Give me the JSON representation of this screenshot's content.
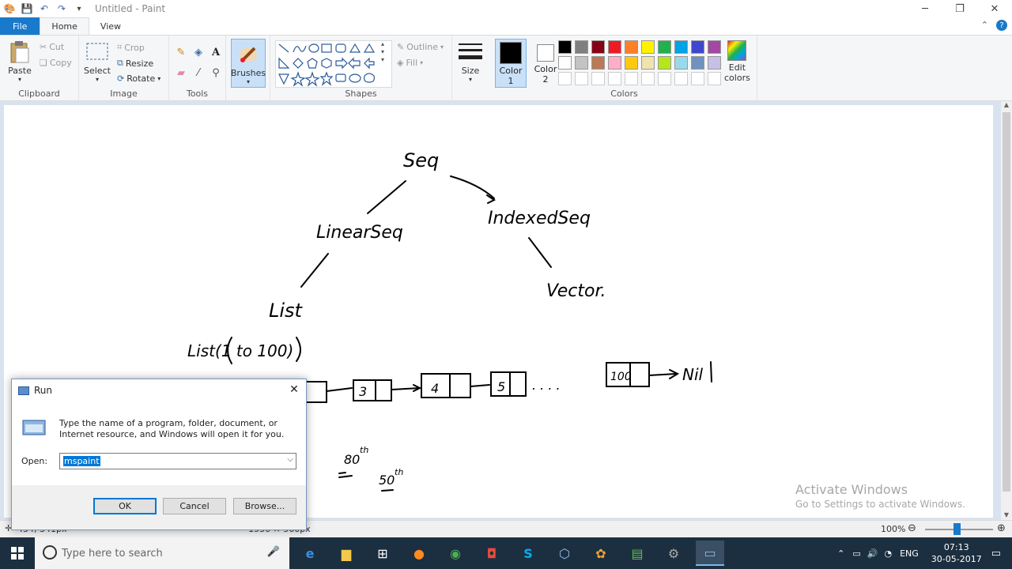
{
  "window": {
    "title": "Untitled - Paint"
  },
  "tabs": [
    {
      "label": "File"
    },
    {
      "label": "Home"
    },
    {
      "label": "View"
    }
  ],
  "ribbon": {
    "clipboard": {
      "label": "Clipboard",
      "paste": "Paste",
      "cut": "Cut",
      "copy": "Copy"
    },
    "image": {
      "label": "Image",
      "select": "Select",
      "crop": "Crop",
      "resize": "Resize",
      "rotate": "Rotate"
    },
    "tools": {
      "label": "Tools"
    },
    "brushes": {
      "label": "Brushes"
    },
    "shapes": {
      "label": "Shapes",
      "outline": "Outline",
      "fill": "Fill"
    },
    "size": {
      "label": "Size"
    },
    "colors": {
      "label": "Colors",
      "color1": "Color",
      "color1_num": "1",
      "color2": "Color",
      "color2_num": "2",
      "edit": "Edit",
      "edit2": "colors",
      "color1_hex": "#000000",
      "color2_hex": "#ffffff",
      "palette_row1": [
        "#000000",
        "#7f7f7f",
        "#880015",
        "#ed1c24",
        "#ff7f27",
        "#fff200",
        "#22b14c",
        "#00a2e8",
        "#3f48cc",
        "#a349a4"
      ],
      "palette_row2": [
        "#ffffff",
        "#c3c3c3",
        "#b97a57",
        "#ffaec9",
        "#ffc90e",
        "#efe4b0",
        "#b5e61d",
        "#99d9ea",
        "#7092be",
        "#c8bfe7"
      ]
    }
  },
  "canvas_text": {
    "seq": "Seq",
    "linear_seq": "LinearSeq",
    "indexed_seq": "IndexedSeq",
    "vector": "Vector.",
    "list": "List",
    "list_call": "List(1 to 100)",
    "node3": "3",
    "node4": "4",
    "node5": "5",
    "dots": ". . . .",
    "node100": "100",
    "nil": "Nil",
    "n80": "80",
    "n80_sup": "th",
    "n50": "50",
    "n50_sup": "th"
  },
  "statusbar": {
    "position": "434, 341px",
    "size": "1536 × 560px",
    "zoom": "100%"
  },
  "watermark": {
    "line1": "Activate Windows",
    "line2": "Go to Settings to activate Windows."
  },
  "run_dialog": {
    "title": "Run",
    "description": "Type the name of a program, folder, document, or Internet resource, and Windows will open it for you.",
    "open_label": "Open:",
    "open_value": "mspaint",
    "ok": "OK",
    "cancel": "Cancel",
    "browse": "Browse..."
  },
  "taskbar": {
    "search_placeholder": "Type here to search",
    "language": "ENG",
    "time": "07:13",
    "date": "30-05-2017"
  }
}
